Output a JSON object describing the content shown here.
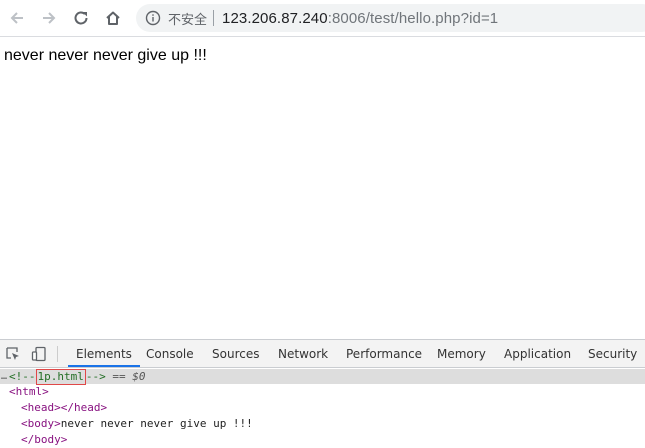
{
  "browser": {
    "security_label": "不安全",
    "url_host": "123.206.87.240",
    "url_rest": ":8006/test/hello.php?id=1"
  },
  "page": {
    "body_text": "never never never give up !!!"
  },
  "devtools": {
    "tabs": [
      {
        "label": "Elements",
        "active": true
      },
      {
        "label": "Console",
        "active": false
      },
      {
        "label": "Sources",
        "active": false
      },
      {
        "label": "Network",
        "active": false
      },
      {
        "label": "Performance",
        "active": false
      },
      {
        "label": "Memory",
        "active": false
      },
      {
        "label": "Application",
        "active": false
      },
      {
        "label": "Security",
        "active": false
      }
    ],
    "dom": {
      "ellipsis": "…",
      "comment_open": "<!--",
      "comment_text": "1p.html",
      "comment_close": "-->",
      "selected_ref": " == $0",
      "html_open": "<html>",
      "head_line": "<head></head>",
      "body_open": "<body>",
      "body_text": "never never never give up !!!",
      "body_close": "</body>"
    }
  },
  "colors": {
    "accent": "#1a73e8",
    "comment": "#236e25",
    "tag": "#881280",
    "highlight_border": "#e04848"
  }
}
